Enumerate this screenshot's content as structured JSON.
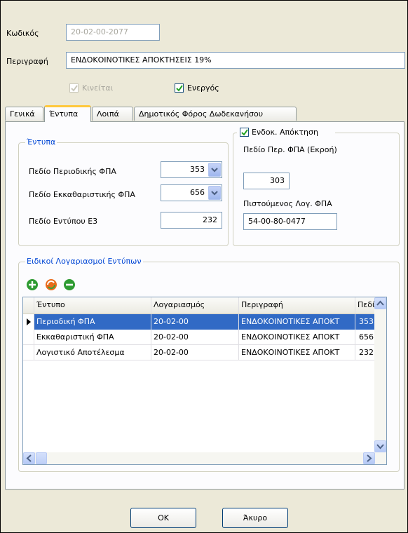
{
  "form": {
    "code_label": "Κωδικός",
    "code_value": "20-02-00-2077",
    "desc_label": "Περιγραφή",
    "desc_value": "ΕΝΔΟΚΟΙΝΟΤΙΚΕΣ ΑΠΟΚΤΗΣΕΙΣ 19%",
    "moves_label": "Κινείται",
    "moves_checked": true,
    "active_label": "Ενεργός",
    "active_checked": true
  },
  "tabs": [
    {
      "label": "Γενικά",
      "active": false
    },
    {
      "label": "Έντυπα",
      "active": true
    },
    {
      "label": "Λοιπά",
      "active": false
    },
    {
      "label": "Δημοτικός Φόρος Δωδεκανήσου",
      "active": false
    }
  ],
  "forms_group": {
    "title": "Έντυπα",
    "periodic_label": "Πεδίο Περιοδικής ΦΠΑ",
    "periodic_value": "353",
    "clearing_label": "Πεδίο Εκκαθαριστικής ΦΠΑ",
    "clearing_value": "656",
    "e3_label": "Πεδίο Εντύπου Ε3",
    "e3_value": "232"
  },
  "intra_group": {
    "checkbox_label": "Ενδοκ. Απόκτηση",
    "checked": true,
    "output_vat_label": "Πεδίο Περ. ΦΠΑ (Εκροή)",
    "output_vat_value": "303",
    "credited_label": "Πιστούμενος Λογ. ΦΠΑ",
    "credited_value": "54-00-80-0477"
  },
  "accounts_group": {
    "title": "Ειδικοί Λογαριασμοί Εντύπων",
    "columns": [
      "Έντυπο",
      "Λογαριασμός",
      "Περιγραφή",
      "Πεδίο"
    ],
    "rows": [
      [
        "Περιοδική ΦΠΑ",
        "20-02-00",
        "ΕΝΔΟΚΟΙΝΟΤΙΚΕΣ ΑΠΟΚΤ",
        "353"
      ],
      [
        "Εκκαθαριστική ΦΠΑ",
        "20-02-00",
        "ΕΝΔΟΚΟΙΝΟΤΙΚΕΣ ΑΠΟΚΤ",
        "656"
      ],
      [
        "Λογιστικό Αποτέλεσμα",
        "20-02-00",
        "ΕΝΔΟΚΟΙΝΟΤΙΚΕΣ ΑΠΟΚΤ",
        "232"
      ]
    ],
    "selected_row": 0
  },
  "buttons": {
    "ok": "ΟΚ",
    "cancel": "Άκυρο"
  },
  "colors": {
    "selection": "#316ac5",
    "legend": "#0046d5",
    "tab_highlight": "#ffc83c",
    "add_icon": "#2e9b32",
    "remove_icon": "#2e9b32"
  },
  "icons": [
    "add-icon",
    "refresh-icon",
    "remove-icon",
    "dropdown-arrow-icon",
    "row-pointer-icon",
    "scroll-up-icon",
    "scroll-down-icon",
    "scroll-left-icon",
    "scroll-right-icon"
  ]
}
